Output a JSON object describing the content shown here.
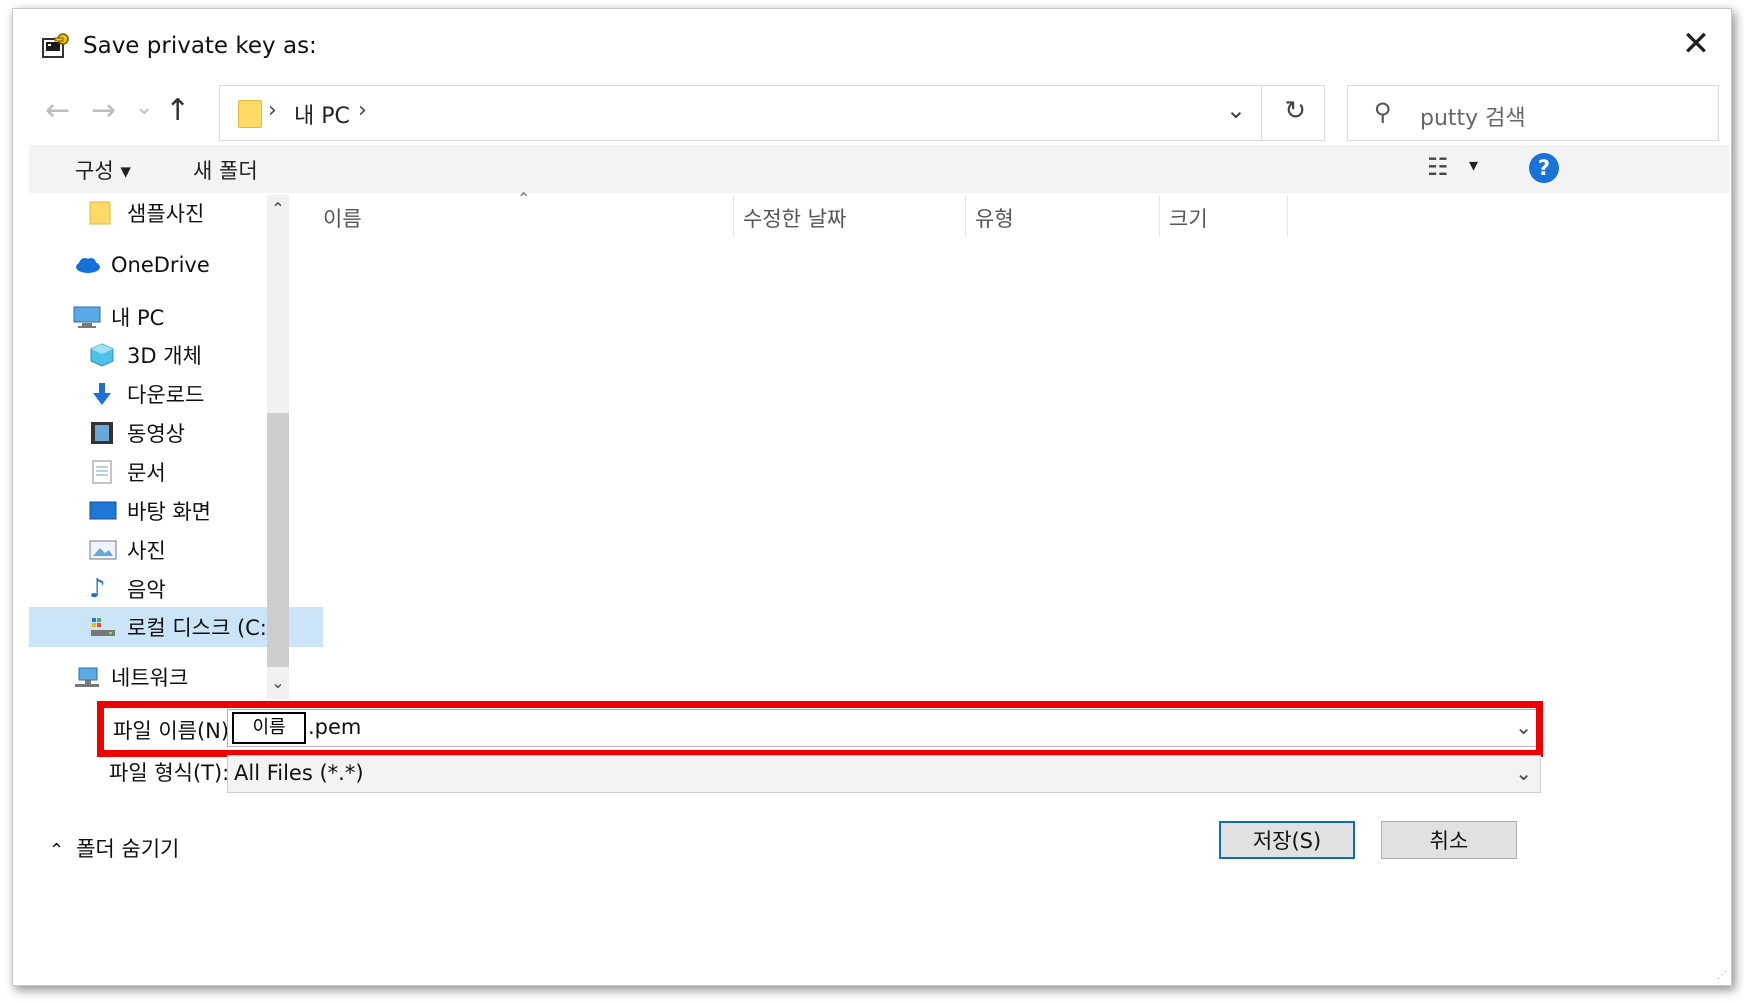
{
  "window": {
    "title": "Save private key as:",
    "close_glyph": "✕"
  },
  "address": {
    "back_glyph": "←",
    "forward_glyph": "→",
    "recent_glyph": "⌄",
    "up_glyph": "↑",
    "path": "내 PC",
    "refresh_glyph": "↻"
  },
  "search": {
    "placeholder": "putty 검색",
    "icon": "search-icon"
  },
  "toolbar": {
    "organize_label": "구성 ▾",
    "new_folder_label": "새 폴더",
    "help_label": "?"
  },
  "nav": {
    "items": [
      {
        "label": "샘플사진",
        "icon": "folder-icon"
      },
      {
        "label": "OneDrive",
        "icon": "cloud-icon"
      },
      {
        "label": "내 PC",
        "icon": "computer-icon"
      },
      {
        "label": "3D 개체",
        "icon": "cube-icon"
      },
      {
        "label": "다운로드",
        "icon": "download-icon"
      },
      {
        "label": "동영상",
        "icon": "video-icon"
      },
      {
        "label": "문서",
        "icon": "document-icon"
      },
      {
        "label": "바탕 화면",
        "icon": "desktop-icon"
      },
      {
        "label": "사진",
        "icon": "picture-icon"
      },
      {
        "label": "음악",
        "icon": "music-icon"
      },
      {
        "label": "로컬 디스크 (C:)",
        "icon": "drive-icon"
      },
      {
        "label": "네트워크",
        "icon": "network-icon"
      }
    ],
    "selected": "로컬 디스크 (C:)"
  },
  "filelist": {
    "columns": [
      "이름",
      "수정한 날짜",
      "유형",
      "크기"
    ]
  },
  "filename": {
    "label": "파일 이름(N):",
    "name_part": "이름",
    "value": ".pem"
  },
  "filetype": {
    "label": "파일 형식(T):",
    "value": "All Files (*.*)"
  },
  "footer": {
    "hide_folders_label": "폴더 숨기기",
    "save_label": "저장(S)",
    "cancel_label": "취소"
  },
  "colors": {
    "highlight": "#ee0000",
    "selection": "#cce4f7",
    "help": "#1a73d9"
  }
}
